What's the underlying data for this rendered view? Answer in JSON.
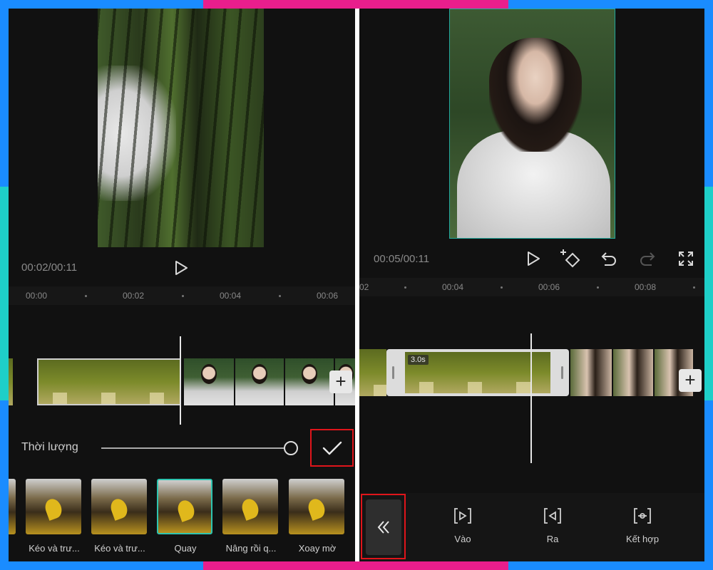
{
  "left": {
    "timecode": "00:02/00:11",
    "ruler": [
      "00:00",
      "00:02",
      "00:04",
      "00:06"
    ],
    "duration_label": "Thời lượng",
    "duration_fraction": 1.0,
    "effects": [
      {
        "label": "Kéo và trư..."
      },
      {
        "label": "Kéo và trư..."
      },
      {
        "label": "Quay",
        "selected": true
      },
      {
        "label": "Nâng rồi q..."
      },
      {
        "label": "Xoay mờ"
      }
    ]
  },
  "right": {
    "timecode": "00:05/00:11",
    "ruler": [
      "02",
      "00:04",
      "00:06",
      "00:08"
    ],
    "clip_duration": "3.0s",
    "tools": [
      {
        "icon": "in-bracket-icon",
        "label": "Vào"
      },
      {
        "icon": "out-bracket-icon",
        "label": "Ra"
      },
      {
        "icon": "combine-bracket-icon",
        "label": "Kết hợp"
      }
    ]
  },
  "colors": {
    "highlight": "#e0151b",
    "selection": "#2ec4b0",
    "frame_blue": "#1a8cff",
    "frame_pink": "#e91e8c",
    "frame_teal": "#1ecfc8"
  }
}
